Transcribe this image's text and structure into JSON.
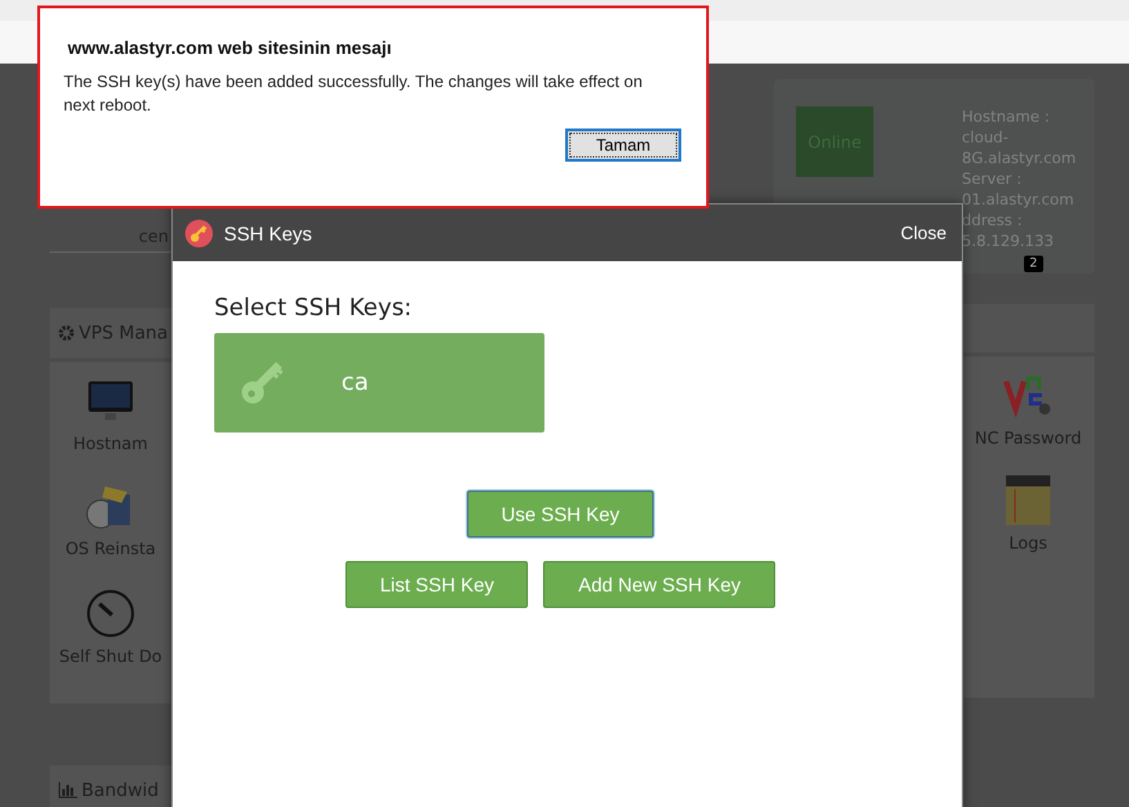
{
  "background": {
    "search_field": {
      "value": "cen"
    },
    "vps_panel": {
      "title": "VPS Mana",
      "tiles": [
        {
          "kind": "monitor",
          "label": "Hostnam"
        },
        {
          "kind": "install",
          "label": "OS Reinsta"
        },
        {
          "kind": "timer",
          "label": "Self Shut Do"
        }
      ]
    },
    "right_tiles": [
      {
        "kind": "vnc",
        "label": "NC Password"
      },
      {
        "kind": "logs",
        "label": "Logs"
      }
    ],
    "bandwidth_panel": {
      "title": "Bandwid"
    },
    "server_card": {
      "status": "Online",
      "lines": [
        "Hostname :",
        "cloud-",
        "8G.alastyr.com",
        "Server :",
        "01.alastyr.com",
        "ddress :",
        "5.8.129.133"
      ],
      "badge": "2"
    }
  },
  "modal": {
    "title": "SSH Keys",
    "close": "Close",
    "heading": "Select SSH Keys:",
    "keys": [
      {
        "name": "ca"
      }
    ],
    "buttons": [
      {
        "label": "Use SSH Key",
        "focused": true
      },
      {
        "label": "List SSH Key",
        "focused": false
      },
      {
        "label": "Add New SSH Key",
        "focused": false
      }
    ]
  },
  "alert": {
    "title": "www.alastyr.com web sitesinin mesajı",
    "message": "The SSH key(s) have been added successfully. The changes will take effect on next reboot.",
    "button": "Tamam"
  }
}
